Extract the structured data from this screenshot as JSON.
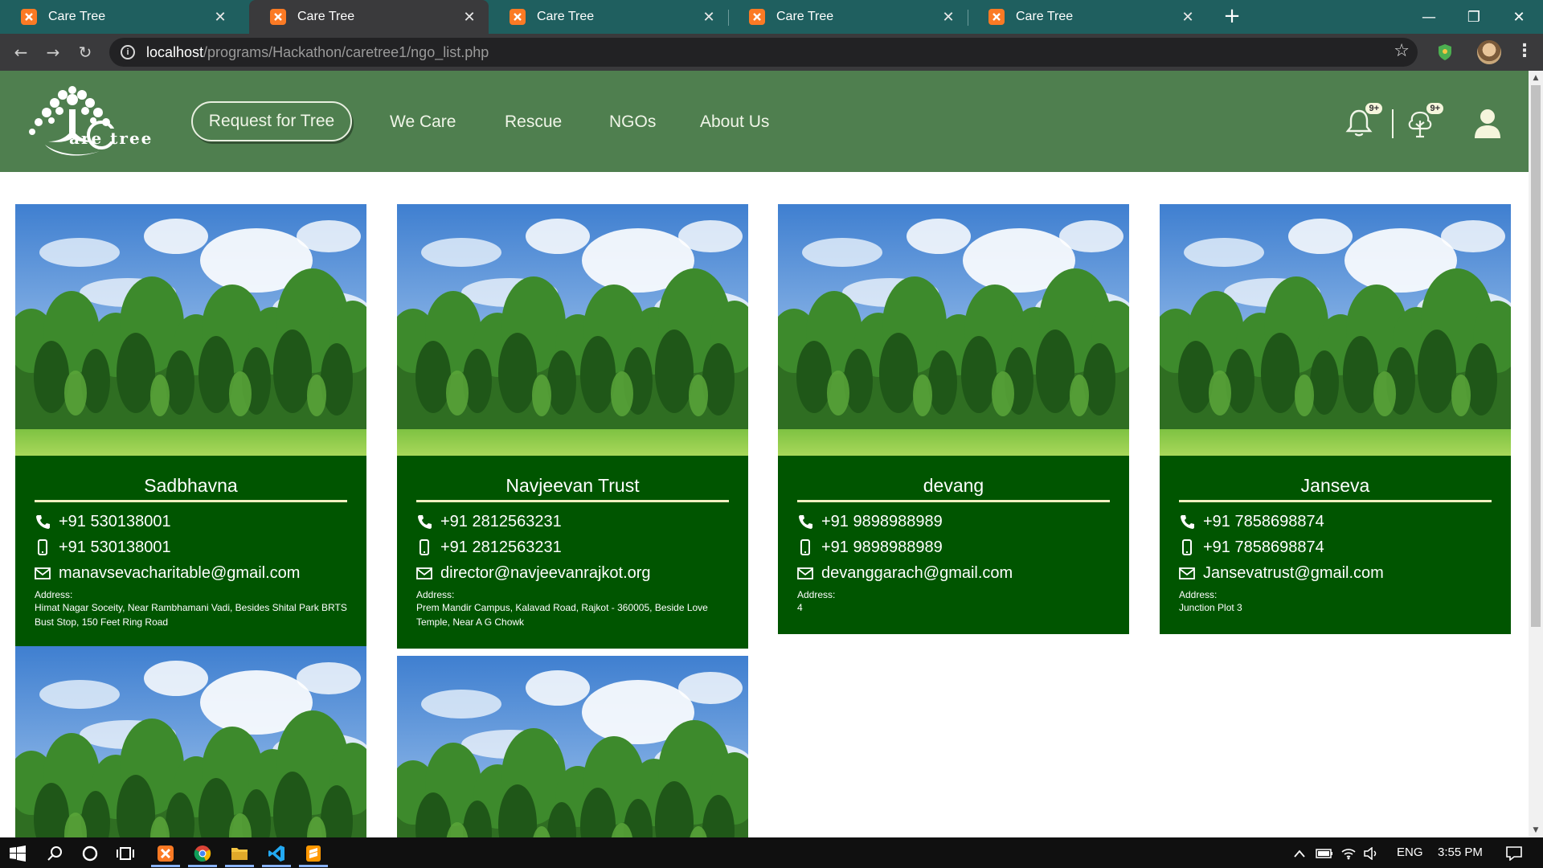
{
  "browser": {
    "tabs": [
      {
        "title": "Care Tree",
        "active": false
      },
      {
        "title": "Care Tree",
        "active": true
      },
      {
        "title": "Care Tree",
        "active": false
      },
      {
        "title": "Care Tree",
        "active": false
      },
      {
        "title": "Care Tree",
        "active": false
      }
    ],
    "url_host": "localhost",
    "url_path": "/programs/Hackathon/caretree1/ngo_list.php"
  },
  "site": {
    "logo_text": "are tree",
    "request_button": "Request for Tree",
    "nav": [
      "We Care",
      "Rescue",
      "NGOs",
      "About Us"
    ],
    "notification_badge": "9+",
    "tree_badge": "9+",
    "colors": {
      "header": "#4f7f4f",
      "card": "#005500",
      "underline": "#f0f0c0"
    }
  },
  "ngos": [
    {
      "name": "Sadbhavna",
      "phone": "+91 530138001",
      "mobile": "+91 530138001",
      "email": "manavsevacharitable@gmail.com",
      "address_label": "Address:",
      "address": "Himat Nagar Soceity, Near Rambhamani Vadi, Besides Shital Park BRTS Bust Stop, 150 Feet Ring Road"
    },
    {
      "name": "Navjeevan Trust",
      "phone": "+91 2812563231",
      "mobile": "+91 2812563231",
      "email": "director@navjeevanrajkot.org",
      "address_label": "Address:",
      "address": "Prem Mandir Campus, Kalavad Road, Rajkot - 360005, Beside Love Temple, Near A G Chowk"
    },
    {
      "name": "devang",
      "phone": "+91 9898988989",
      "mobile": "+91 9898988989",
      "email": "devanggarach@gmail.com",
      "address_label": "Address:",
      "address": "4"
    },
    {
      "name": "Janseva",
      "phone": "+91 7858698874",
      "mobile": "+91 7858698874",
      "email": "Jansevatrust@gmail.com",
      "address_label": "Address:",
      "address": "Junction Plot 3"
    }
  ],
  "taskbar": {
    "language": "ENG",
    "time": "3:55 PM"
  }
}
